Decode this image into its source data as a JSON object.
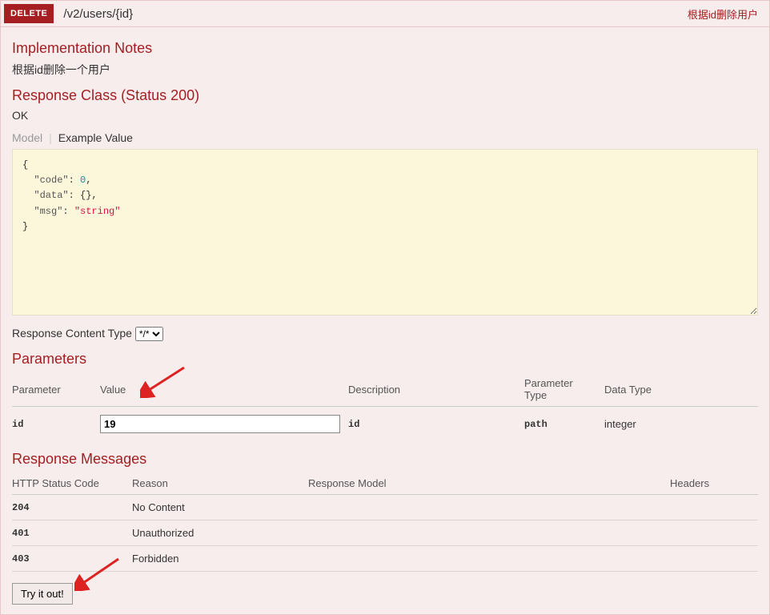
{
  "heading": {
    "method": "DELETE",
    "path": "/v2/users/{id}",
    "summary": "根据id删除用户"
  },
  "impl_notes": {
    "title": "Implementation Notes",
    "text": "根据id删除一个用户"
  },
  "response_class": {
    "title": "Response Class (Status 200)",
    "status_text": "OK",
    "tabs": {
      "model": "Model",
      "example": "Example Value"
    },
    "example_json": {
      "code": 0,
      "data": {},
      "msg": "string"
    }
  },
  "content_type": {
    "label": "Response Content Type",
    "selected": "*/*",
    "options": [
      "*/*"
    ]
  },
  "parameters": {
    "title": "Parameters",
    "headers": {
      "parameter": "Parameter",
      "value": "Value",
      "description": "Description",
      "param_type": "Parameter Type",
      "data_type": "Data Type"
    },
    "rows": [
      {
        "name": "id",
        "value": "19",
        "description": "id",
        "param_type": "path",
        "data_type": "integer"
      }
    ]
  },
  "response_messages": {
    "title": "Response Messages",
    "headers": {
      "status": "HTTP Status Code",
      "reason": "Reason",
      "model": "Response Model",
      "headers": "Headers"
    },
    "rows": [
      {
        "code": "204",
        "reason": "No Content",
        "model": "",
        "headers": ""
      },
      {
        "code": "401",
        "reason": "Unauthorized",
        "model": "",
        "headers": ""
      },
      {
        "code": "403",
        "reason": "Forbidden",
        "model": "",
        "headers": ""
      }
    ]
  },
  "try_button": "Try it out!"
}
